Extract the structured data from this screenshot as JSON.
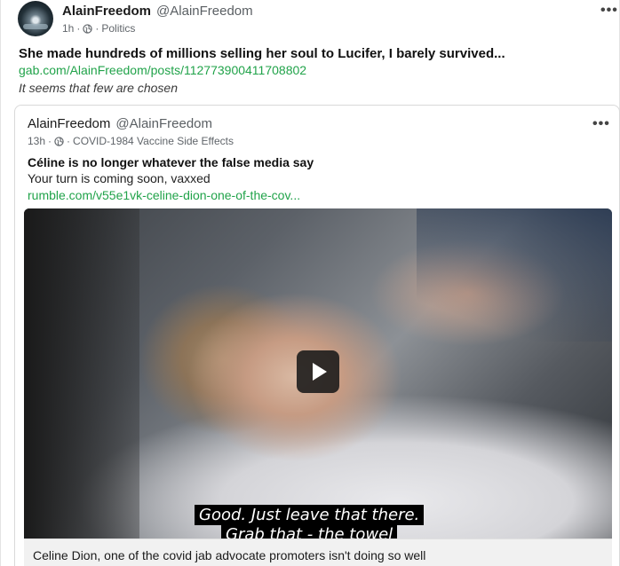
{
  "post": {
    "author_name": "AlainFreedom",
    "author_handle": "@AlainFreedom",
    "time": "1h",
    "separator": "·",
    "category": "Politics",
    "title": "She made hundreds of millions selling her soul to Lucifer, I barely survived...",
    "link": "gab.com/AlainFreedom/posts/112773900411708802",
    "subtext": "It seems that few are chosen",
    "more_icon": "•••"
  },
  "quoted": {
    "author_name": "AlainFreedom",
    "author_handle": "@AlainFreedom",
    "time": "13h",
    "separator": "·",
    "category": "COVID-1984 Vaccine Side Effects",
    "title": "Céline is no longer whatever the false media say",
    "body": "Your turn is coming soon, vaxxed",
    "link": "rumble.com/v55e1vk-celine-dion-one-of-the-cov...",
    "more_icon": "•••",
    "video": {
      "subtitle_line1": "Good. Just leave that there.",
      "subtitle_line2": "Grab that - the towel",
      "caption": "Celine Dion, one of the covid jab advocate promoters isn't doing so well"
    }
  },
  "colors": {
    "link": "#21a34a",
    "text": "#1a1a1a",
    "muted": "#60656a"
  },
  "icons": [
    "avatar",
    "globe-icon",
    "more-options-icon",
    "play-icon"
  ]
}
